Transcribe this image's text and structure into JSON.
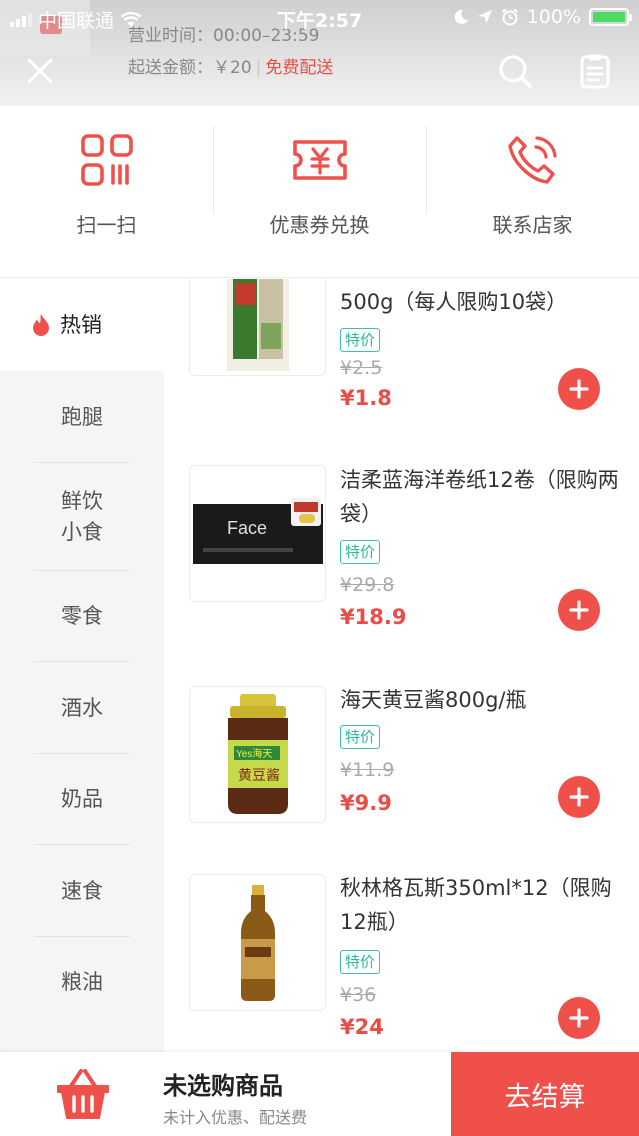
{
  "status_bar": {
    "carrier": "中国联通",
    "time": "下午2:57",
    "battery": "100%"
  },
  "store": {
    "hours": "营业时间：00:00–23:59",
    "min_order": "起送金额：￥20",
    "delivery": "免费配送"
  },
  "quick_actions": [
    {
      "label": "扫一扫",
      "icon": "scan-icon"
    },
    {
      "label": "优惠券兑换",
      "icon": "coupon-icon"
    },
    {
      "label": "联系店家",
      "icon": "phone-icon"
    }
  ],
  "categories": [
    {
      "label": "热销",
      "icon": "flame-icon",
      "active": true
    },
    {
      "label": "跑腿"
    },
    {
      "label": "鲜饮小食",
      "line1": "鲜饮",
      "line2": "小食"
    },
    {
      "label": "零食"
    },
    {
      "label": "酒水"
    },
    {
      "label": "奶品"
    },
    {
      "label": "速食"
    },
    {
      "label": "粮油"
    }
  ],
  "products": [
    {
      "name": "500g（每人限购10袋）",
      "tag": "特价",
      "original_price": "¥2.5",
      "price": "¥1.8"
    },
    {
      "name": "洁柔蓝海洋卷纸12卷（限购两袋）",
      "tag": "特价",
      "original_price": "¥29.8",
      "price": "¥18.9"
    },
    {
      "name": "海天黄豆酱800g/瓶",
      "tag": "特价",
      "original_price": "¥11.9",
      "price": "¥9.9"
    },
    {
      "name": "秋林格瓦斯350ml*12（限购12瓶）",
      "tag": "特价",
      "original_price": "¥36",
      "price": "¥24"
    }
  ],
  "product_labels": {
    "paper_brand": "Face",
    "sauce_brand": "Yes海天",
    "sauce_label": "黄豆酱"
  },
  "cart": {
    "title": "未选购商品",
    "subtitle": "未计入优惠、配送费",
    "checkout": "去结算"
  },
  "colors": {
    "accent": "#f0504a",
    "tag": "#2eb89e",
    "sidebar_bg": "#f5f5f5"
  }
}
